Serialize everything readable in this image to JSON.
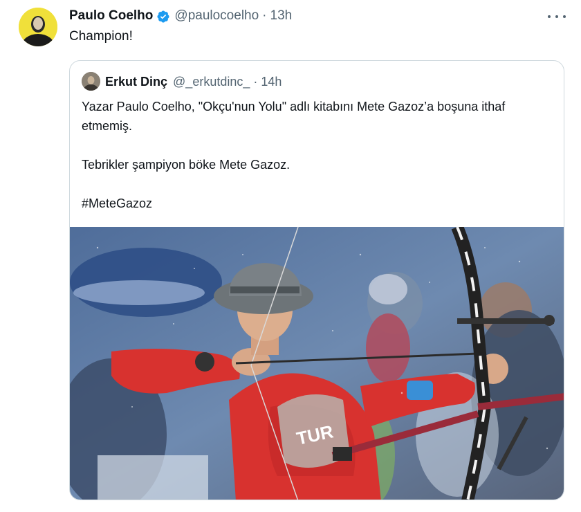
{
  "tweet": {
    "author_name": "Paulo Coelho",
    "author_handle": "@paulocoelho",
    "separator": "·",
    "time": "13h",
    "text": "Champion!",
    "avatar_icon": "profile-avatar",
    "verified_icon": "verified-badge-icon",
    "more_icon": "more-options-icon",
    "verified_color": "#1d9bf0"
  },
  "quote": {
    "author_name": "Erkut Dinç",
    "author_handle": "@_erkutdinc_",
    "separator": "·",
    "time": "14h",
    "lines": [
      "Yazar Paulo Coelho, \"Okçu'nun Yolu\" adlı kitabını Mete Gazoz’a boşuna ithaf etmemiş.",
      "Tebrikler şampiyon böke Mete Gazoz.",
      "#MeteGazoz"
    ],
    "media_icon": "archer-photo"
  },
  "colors": {
    "text": "#0f1419",
    "secondary": "#536471",
    "border": "#cfd9de"
  }
}
